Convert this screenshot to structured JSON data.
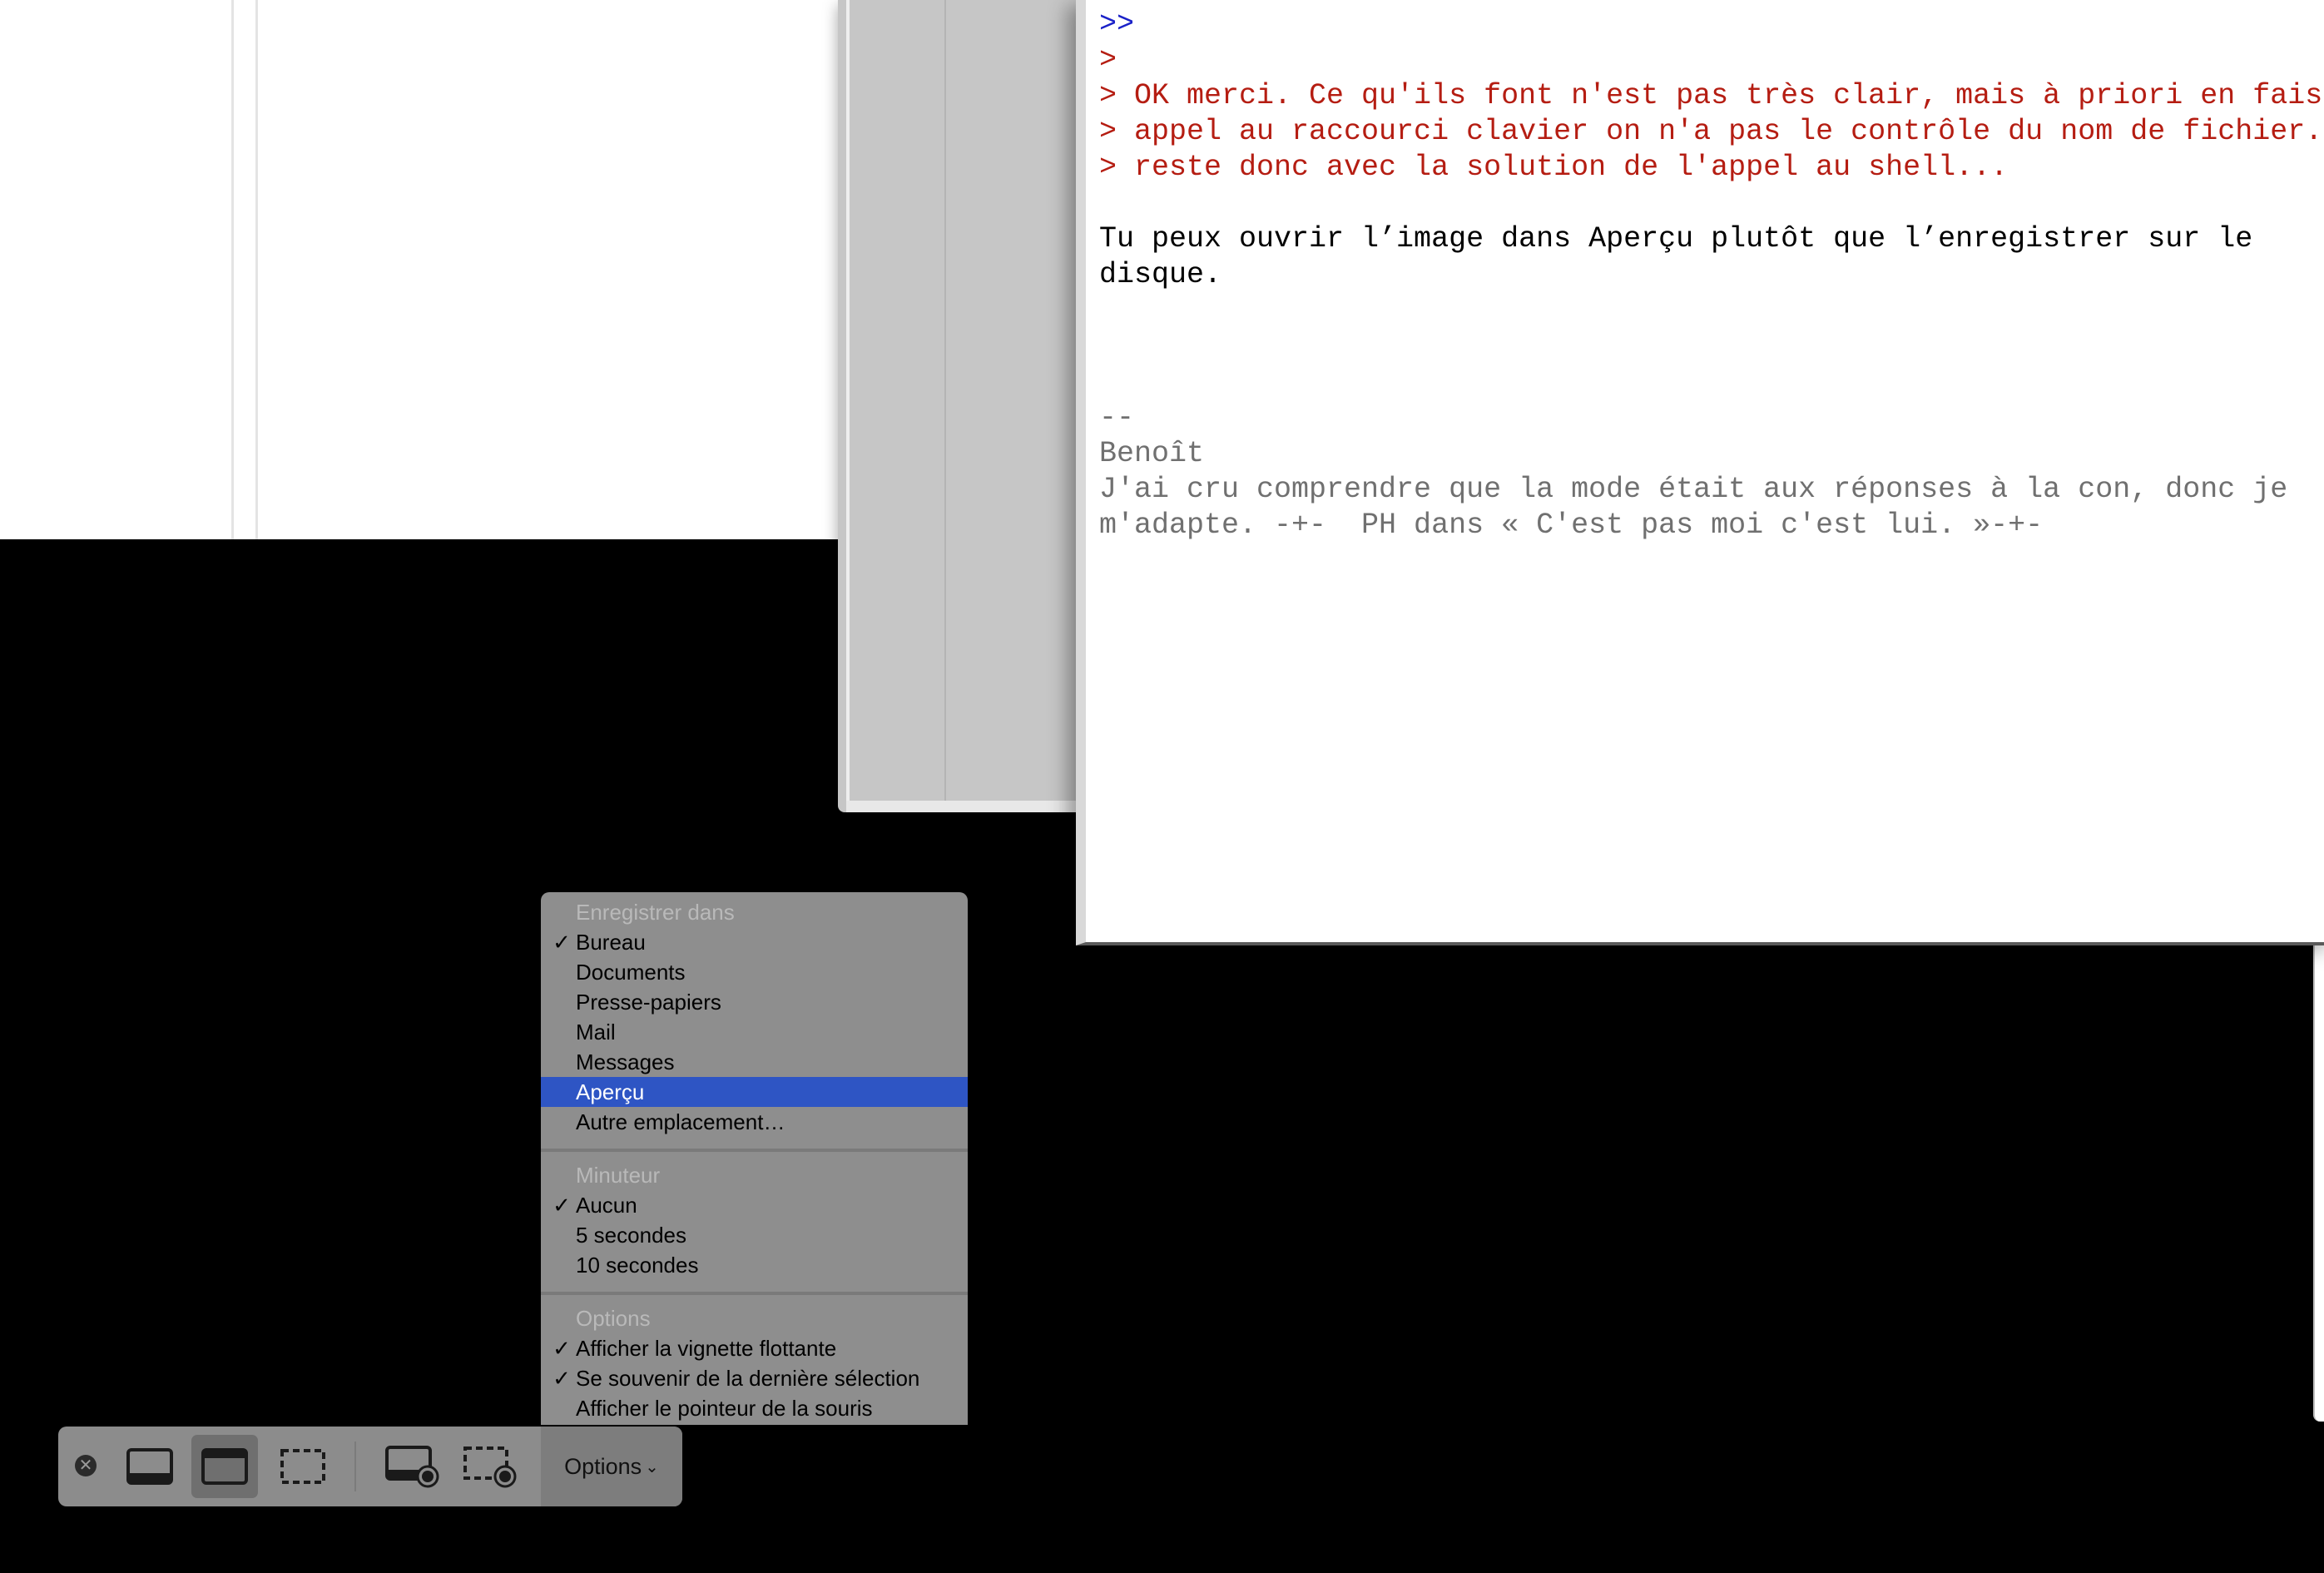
{
  "mail": {
    "lines": [
      {
        "kind": "q2",
        "text": ">>"
      },
      {
        "kind": "q1",
        "text": ">"
      },
      {
        "kind": "q1",
        "text": "> OK merci. Ce qu'ils font n'est pas très clair, mais à priori en faisant"
      },
      {
        "kind": "q1",
        "text": "> appel au raccourci clavier on n'a pas le contrôle du nom de fichier. Je"
      },
      {
        "kind": "q1",
        "text": "> reste donc avec la solution de l'appel au shell..."
      },
      {
        "kind": "blank",
        "text": ""
      },
      {
        "kind": "body",
        "text": "Tu peux ouvrir l’image dans Aperçu plutôt que l’enregistrer sur le"
      },
      {
        "kind": "body",
        "text": "disque."
      },
      {
        "kind": "blank",
        "text": ""
      },
      {
        "kind": "blank",
        "text": ""
      },
      {
        "kind": "blank",
        "text": ""
      },
      {
        "kind": "sig",
        "text": "--"
      },
      {
        "kind": "sig",
        "text": "Benoît"
      },
      {
        "kind": "sig",
        "text": "J'ai cru comprendre que la mode était aux réponses à la con, donc je"
      },
      {
        "kind": "sig",
        "text": "m'adapte. -+-  PH dans « C'est pas moi c'est lui. »-+-"
      }
    ]
  },
  "menu": {
    "save_section": {
      "header": "Enregistrer dans",
      "items": [
        {
          "label": "Bureau",
          "checked": true,
          "selected": false
        },
        {
          "label": "Documents",
          "checked": false,
          "selected": false
        },
        {
          "label": "Presse-papiers",
          "checked": false,
          "selected": false
        },
        {
          "label": "Mail",
          "checked": false,
          "selected": false
        },
        {
          "label": "Messages",
          "checked": false,
          "selected": false
        },
        {
          "label": "Aperçu",
          "checked": false,
          "selected": true
        },
        {
          "label": "Autre emplacement…",
          "checked": false,
          "selected": false
        }
      ]
    },
    "timer_section": {
      "header": "Minuteur",
      "items": [
        {
          "label": "Aucun",
          "checked": true,
          "selected": false
        },
        {
          "label": "5 secondes",
          "checked": false,
          "selected": false
        },
        {
          "label": "10 secondes",
          "checked": false,
          "selected": false
        }
      ]
    },
    "options_section": {
      "header": "Options",
      "items": [
        {
          "label": "Afficher la vignette flottante",
          "checked": true,
          "selected": false
        },
        {
          "label": "Se souvenir de la dernière sélection",
          "checked": true,
          "selected": false
        },
        {
          "label": "Afficher le pointeur de la souris",
          "checked": false,
          "selected": false
        }
      ]
    },
    "check_glyph": "✓"
  },
  "toolbar": {
    "close_glyph": "✕",
    "options_label": "Options",
    "options_chevron": "⌄",
    "active_tool": "capture-window"
  },
  "colors": {
    "quote_level_2": "#1b22c8",
    "quote_level_1": "#b51d12",
    "signature": "#707070",
    "menu_highlight": "#2e55c4"
  }
}
